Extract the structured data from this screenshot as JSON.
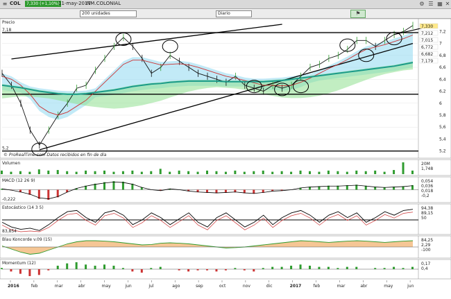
{
  "window": {
    "title": "COL",
    "price": "7,330 (+1,10%)",
    "date": "11-may-2017",
    "name": "INM.COLONIAL"
  },
  "toolbar": {
    "units_select": "200 unidades",
    "period_select": "Diario"
  },
  "chart_data": [
    {
      "type": "line",
      "panel": "Precio",
      "source_note": "© ProRealTime.com  Datos recibidos en fin de día",
      "x_labels": [
        "2016",
        "feb",
        "mar",
        "abr",
        "may",
        "jun",
        "jul",
        "ago",
        "sep",
        "oct",
        "nov",
        "dic",
        "2017",
        "feb",
        "mar",
        "abr",
        "may",
        "jun"
      ],
      "y_ticks": [
        5.2,
        5.4,
        5.6,
        5.8,
        6,
        6.2,
        6.4,
        6.6,
        6.8,
        7,
        7.2
      ],
      "ylim": [
        5.15,
        7.32
      ],
      "right_labels": [
        "7,330",
        "7,212",
        "7,015",
        "6,772",
        "6,682",
        "7,179"
      ],
      "left_labels": [
        "7,18",
        "5,2"
      ],
      "series": [
        {
          "name": "close",
          "color": "#111111",
          "values": [
            6.5,
            6.3,
            6.0,
            5.55,
            5.3,
            5.55,
            5.8,
            6.0,
            6.25,
            6.3,
            6.55,
            6.75,
            6.95,
            7.1,
            6.95,
            6.75,
            6.5,
            6.6,
            6.8,
            6.7,
            6.6,
            6.5,
            6.45,
            6.4,
            6.35,
            6.45,
            6.3,
            6.25,
            6.2,
            6.3,
            6.25,
            6.3,
            6.45,
            6.6,
            6.65,
            6.75,
            6.8,
            6.9,
            7.05,
            7.05,
            6.95,
            7.05,
            7.15,
            7.2,
            7.3
          ]
        },
        {
          "name": "sma",
          "color": "#cc3333",
          "values": [
            6.45,
            6.4,
            6.3,
            6.15,
            5.95,
            5.85,
            5.8,
            5.85,
            5.95,
            6.05,
            6.2,
            6.35,
            6.5,
            6.65,
            6.72,
            6.72,
            6.68,
            6.64,
            6.65,
            6.66,
            6.64,
            6.6,
            6.55,
            6.5,
            6.45,
            6.42,
            6.38,
            6.34,
            6.3,
            6.3,
            6.29,
            6.3,
            6.35,
            6.42,
            6.5,
            6.58,
            6.65,
            6.73,
            6.82,
            6.9,
            6.94,
            6.98,
            7.03,
            7.08,
            7.14
          ]
        },
        {
          "name": "ma200",
          "color": "#1a9a8a",
          "values": [
            6.3,
            6.28,
            6.26,
            6.23,
            6.2,
            6.18,
            6.16,
            6.15,
            6.15,
            6.16,
            6.18,
            6.2,
            6.22,
            6.25,
            6.28,
            6.3,
            6.32,
            6.33,
            6.35,
            6.36,
            6.37,
            6.37,
            6.37,
            6.37,
            6.36,
            6.36,
            6.36,
            6.36,
            6.36,
            6.37,
            6.38,
            6.4,
            6.42,
            6.44,
            6.46,
            6.48,
            6.5,
            6.52,
            6.54,
            6.56,
            6.58,
            6.6,
            6.62,
            6.65,
            6.68
          ]
        }
      ],
      "annotations": {
        "horizontal_levels": [
          7.18,
          6.15,
          5.2
        ],
        "upper_channel": [
          [
            1,
            6.74
          ],
          [
            30,
            7.32
          ]
        ],
        "lower_channel": [
          [
            4,
            5.22
          ],
          [
            44,
            7.0
          ]
        ],
        "circle_points": [
          [
            4,
            5.23
          ],
          [
            13,
            7.07
          ],
          [
            18,
            6.95
          ],
          [
            27,
            6.28
          ],
          [
            30,
            6.23
          ],
          [
            32,
            6.28
          ],
          [
            37,
            6.97
          ],
          [
            39,
            6.8
          ],
          [
            42,
            7.08
          ]
        ]
      }
    },
    {
      "type": "bar",
      "panel": "Volumen",
      "right_labels": [
        "20M",
        "1,748"
      ],
      "values": [
        0.3,
        0.2,
        0.25,
        0.2,
        0.4,
        0.3,
        0.35,
        0.25,
        0.2,
        0.3,
        0.25,
        0.3,
        0.2,
        0.25,
        0.3,
        0.2,
        0.25,
        0.45,
        0.2,
        0.3,
        0.25,
        0.2,
        0.3,
        0.25,
        0.2,
        0.3,
        0.2,
        0.25,
        0.3,
        0.2,
        0.25,
        0.2,
        0.3,
        0.25,
        0.2,
        0.3,
        0.25,
        0.2,
        0.3,
        0.25,
        0.3,
        0.2,
        0.35,
        1.0,
        0.3
      ]
    },
    {
      "type": "line",
      "panel": "MACD (12 26 9)",
      "right_labels": [
        "0,054",
        "0,036",
        "0,018",
        "-0,2"
      ],
      "left_labels": [
        "-0,222"
      ],
      "values": [
        0.02,
        -0.01,
        -0.05,
        -0.1,
        -0.18,
        -0.2,
        -0.15,
        -0.05,
        0.03,
        0.08,
        0.12,
        0.15,
        0.17,
        0.16,
        0.12,
        0.05,
        0.0,
        -0.02,
        0.02,
        0.0,
        -0.03,
        -0.05,
        -0.06,
        -0.07,
        -0.06,
        -0.05,
        -0.07,
        -0.08,
        -0.06,
        -0.03,
        -0.02,
        0.0,
        0.04,
        0.06,
        0.07,
        0.08,
        0.08,
        0.09,
        0.1,
        0.08,
        0.06,
        0.05,
        0.06,
        0.07,
        0.09
      ]
    },
    {
      "type": "line",
      "panel": "Estocástico (14 3 5)",
      "right_labels": [
        "94,38",
        "89,15",
        "50"
      ],
      "left_labels": [
        "83,854"
      ],
      "values": [
        40,
        20,
        10,
        15,
        5,
        30,
        60,
        85,
        90,
        60,
        40,
        80,
        90,
        70,
        30,
        50,
        80,
        60,
        30,
        55,
        80,
        40,
        20,
        60,
        80,
        50,
        20,
        40,
        70,
        30,
        60,
        80,
        90,
        70,
        40,
        70,
        85,
        60,
        80,
        40,
        60,
        85,
        70,
        90,
        95
      ]
    },
    {
      "type": "area",
      "panel": "Blau Koncorde v.09 (15)",
      "right_labels": [
        "84,25",
        "2,29",
        "-100"
      ],
      "values": [
        5,
        -10,
        -25,
        -35,
        -30,
        -15,
        0,
        15,
        25,
        30,
        30,
        28,
        25,
        20,
        15,
        10,
        12,
        18,
        20,
        18,
        15,
        10,
        5,
        0,
        -5,
        -3,
        0,
        5,
        10,
        15,
        20,
        25,
        30,
        28,
        25,
        22,
        25,
        28,
        30,
        28,
        25,
        22,
        25,
        28,
        30
      ]
    },
    {
      "type": "bar",
      "panel": "Momentum (12)",
      "right_labels": [
        "0,17",
        "0,4"
      ],
      "values": [
        0.1,
        -0.2,
        -0.4,
        -0.6,
        -0.5,
        -0.1,
        0.3,
        0.5,
        0.6,
        0.4,
        0.3,
        0.4,
        0.3,
        0.1,
        -0.2,
        -0.3,
        0.1,
        0.2,
        0.0,
        -0.1,
        -0.2,
        -0.1,
        -0.1,
        -0.2,
        -0.1,
        0.1,
        -0.1,
        -0.2,
        0.1,
        0.2,
        0.2,
        0.3,
        0.4,
        0.3,
        0.2,
        0.2,
        0.1,
        0.2,
        0.2,
        0.0,
        0.1,
        0.1,
        0.2,
        0.1,
        0.2
      ]
    }
  ],
  "colors": {
    "up_bar": "#2e9b2e",
    "down_bar": "#cc3333",
    "cloud_green": "#90e090",
    "cloud_blue": "#90d8f0"
  },
  "icons": [
    "menu-icon",
    "settings-icon",
    "close-icon",
    "alert-icon"
  ]
}
